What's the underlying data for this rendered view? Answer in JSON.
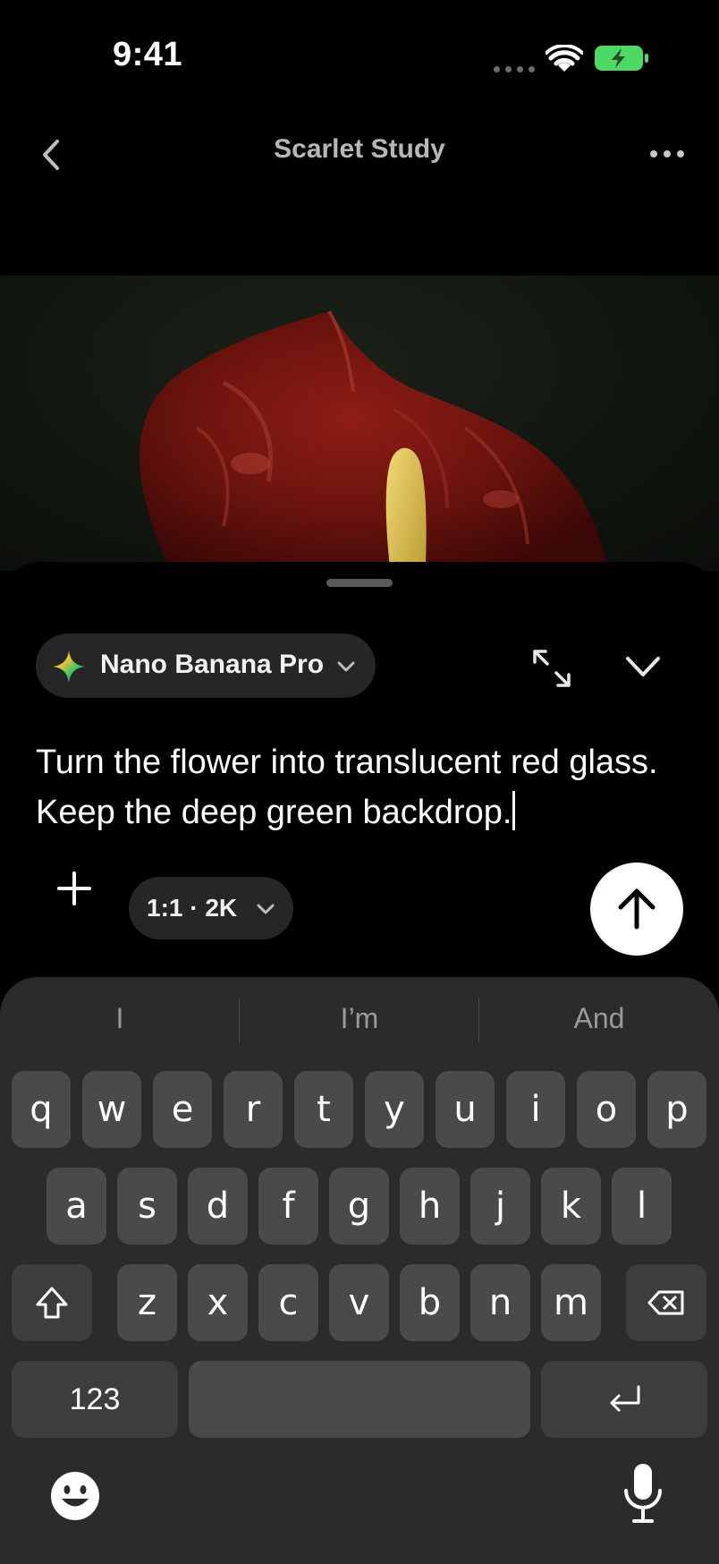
{
  "status_bar": {
    "time": "9:41",
    "wifi_icon": "wifi-icon",
    "battery_icon": "battery-charging-icon",
    "battery_color": "#4cd964"
  },
  "nav": {
    "title": "Scarlet Study",
    "back_icon": "chevron-left-icon",
    "more_icon": "ellipsis-icon"
  },
  "composer": {
    "model": {
      "label": "Nano Banana Pro",
      "icon": "sparkle-icon"
    },
    "prompt": "Turn the flower into translucent red glass. Keep the deep green backdrop.",
    "aspect": {
      "label": "1:1 · 2K"
    },
    "add_icon": "plus-icon",
    "send_icon": "arrow-up-icon",
    "expand_icon": "expand-icon",
    "collapse_icon": "chevron-down-icon"
  },
  "keyboard": {
    "suggestions": [
      "I",
      "I’m",
      "And"
    ],
    "row1": [
      "q",
      "w",
      "e",
      "r",
      "t",
      "y",
      "u",
      "i",
      "o",
      "p"
    ],
    "row2": [
      "a",
      "s",
      "d",
      "f",
      "g",
      "h",
      "j",
      "k",
      "l"
    ],
    "row3": [
      "z",
      "x",
      "c",
      "v",
      "b",
      "n",
      "m"
    ],
    "numbers_label": "123",
    "shift_icon": "shift-icon",
    "delete_icon": "backspace-icon",
    "return_icon": "return-icon",
    "emoji_icon": "emoji-icon",
    "mic_icon": "microphone-icon"
  }
}
